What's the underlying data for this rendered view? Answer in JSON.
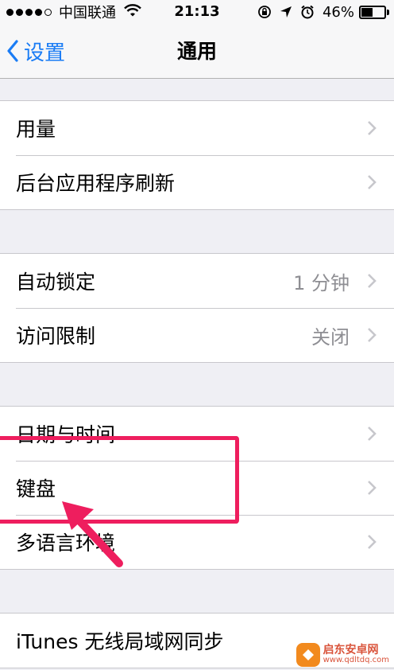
{
  "status_bar": {
    "carrier": "中国联通",
    "time": "21:13",
    "battery_percent": "46%",
    "battery_level": 0.46,
    "icons": [
      "signal-dots",
      "wifi-icon",
      "rotation-lock-icon",
      "location-arrow-icon",
      "alarm-icon",
      "battery-icon"
    ]
  },
  "nav": {
    "back_label": "设置",
    "title": "通用"
  },
  "groups": [
    {
      "rows": [
        {
          "label": "用量",
          "value": ""
        },
        {
          "label": "后台应用程序刷新",
          "value": ""
        }
      ]
    },
    {
      "rows": [
        {
          "label": "自动锁定",
          "value": "1 分钟"
        },
        {
          "label": "访问限制",
          "value": "关闭"
        }
      ]
    },
    {
      "rows": [
        {
          "label": "日期与时间",
          "value": ""
        },
        {
          "label": "键盘",
          "value": ""
        },
        {
          "label": "多语言环境",
          "value": ""
        }
      ]
    },
    {
      "rows": [
        {
          "label": "iTunes 无线局域网同步",
          "value": ""
        }
      ]
    }
  ],
  "watermark": {
    "name": "启东安卓网",
    "url": "www.qdltdq.com"
  },
  "colors": {
    "accent": "#1a7cf5",
    "annotation": "#ee1e5e",
    "background": "#efeff4",
    "secondary_text": "#8e8e93"
  }
}
